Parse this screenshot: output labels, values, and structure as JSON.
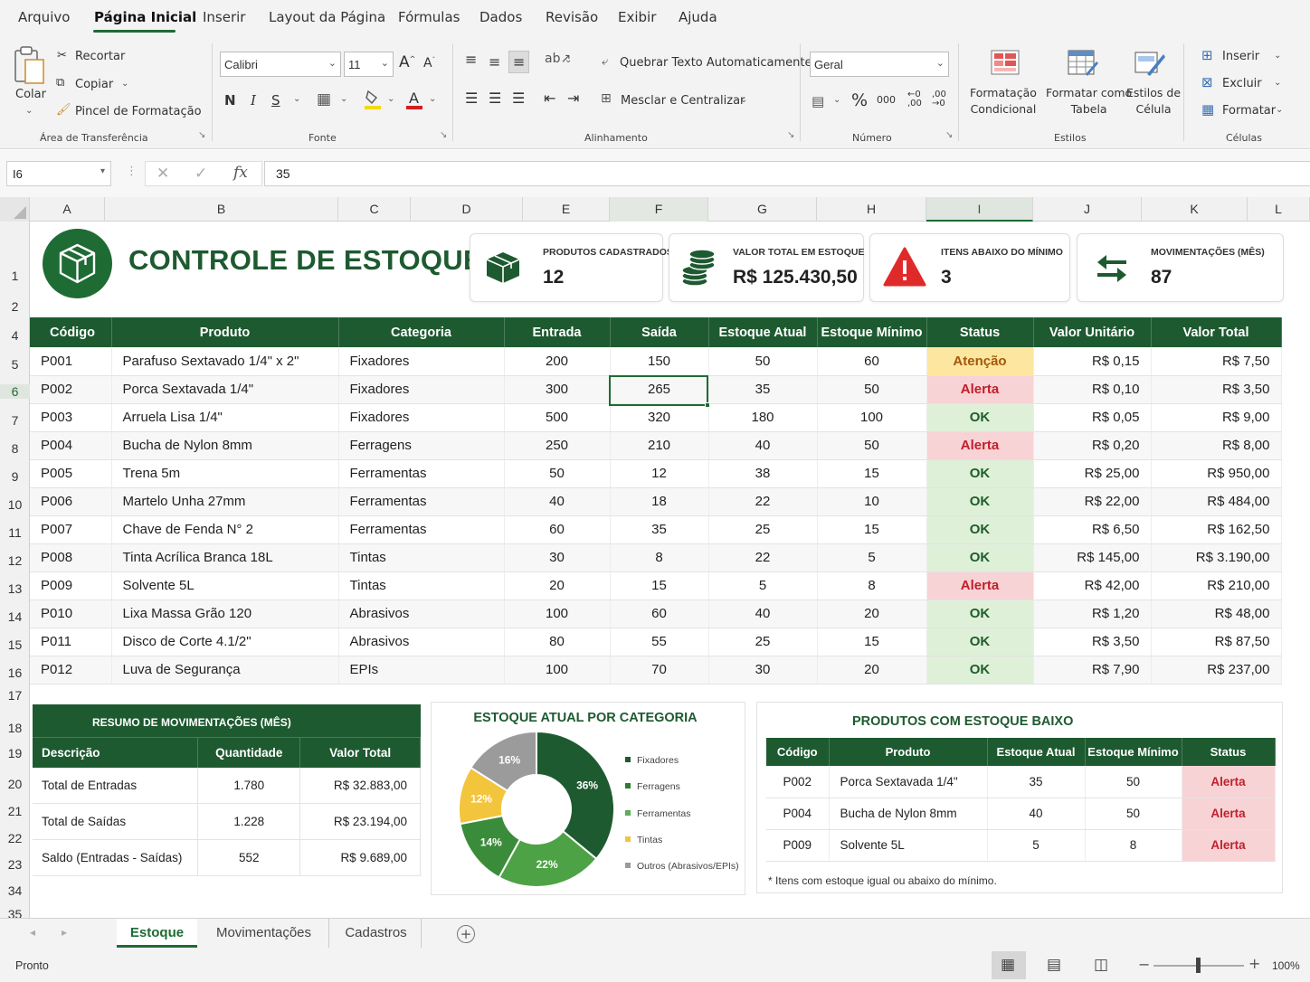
{
  "menu": {
    "tabs": [
      "Arquivo",
      "Página Inicial",
      "Inserir",
      "Layout da Página",
      "Fórmulas",
      "Dados",
      "Revisão",
      "Exibir",
      "Ajuda"
    ],
    "active": "Página Inicial"
  },
  "ribbon": {
    "clipboard": {
      "paste": "Colar",
      "cut": "Recortar",
      "copy": "Copiar",
      "format_painter": "Pincel de Formatação",
      "group": "Área de Transferência"
    },
    "font": {
      "name": "Calibri",
      "size": "11",
      "bold": "N",
      "italic": "I",
      "underline": "S",
      "group": "Fonte"
    },
    "alignment": {
      "wrap": "Quebrar Texto Automaticamente",
      "merge": "Mesclar e Centralizar",
      "group": "Alinhamento"
    },
    "number": {
      "format": "Geral",
      "percent": "%",
      "thousands": "000",
      "group": "Número"
    },
    "styles": {
      "conditional": "Formatação\nCondicional",
      "table": "Formatar como\nTabela",
      "cell_styles": "Estilos de\nCélula",
      "group": "Estilos"
    },
    "cells": {
      "insert": "Inserir",
      "delete": "Excluir",
      "format": "Formatar",
      "group": "Células"
    }
  },
  "formula_bar": {
    "name_box": "I6",
    "value": "35",
    "fx": "fx"
  },
  "columns": [
    "A",
    "B",
    "C",
    "D",
    "E",
    "F",
    "G",
    "H",
    "I",
    "J",
    "K",
    "L"
  ],
  "selected_column": "I",
  "rows": [
    "1",
    "2",
    "4",
    "5",
    "6",
    "7",
    "8",
    "9",
    "10",
    "11",
    "12",
    "13",
    "14",
    "15",
    "16",
    "17",
    "18",
    "19",
    "20",
    "21",
    "22",
    "23",
    "34",
    "35"
  ],
  "selected_row": "6",
  "dashboard": {
    "title": "CONTROLE DE ESTOQUE",
    "kpis": [
      {
        "label": "PRODUTOS CADASTRADOS",
        "value": "12"
      },
      {
        "label": "VALOR TOTAL EM ESTOQUE",
        "value": "R$ 125.430,50"
      },
      {
        "label": "ITENS ABAIXO DO MÍNIMO",
        "value": "3"
      },
      {
        "label": "MOVIMENTAÇÕES (MÊS)",
        "value": "87"
      }
    ]
  },
  "inventory": {
    "headers": [
      "Código",
      "Produto",
      "Categoria",
      "Entrada",
      "Saída",
      "Estoque Atual",
      "Estoque Mínimo",
      "Status",
      "Valor Unitário",
      "Valor Total"
    ],
    "rows": [
      [
        "P001",
        "Parafuso Sextavado 1/4\" x 2\"",
        "Fixadores",
        "200",
        "150",
        "50",
        "60",
        "Atenção",
        "R$ 0,15",
        "R$ 7,50"
      ],
      [
        "P002",
        "Porca Sextavada 1/4\"",
        "Fixadores",
        "300",
        "265",
        "35",
        "50",
        "Alerta",
        "R$ 0,10",
        "R$ 3,50"
      ],
      [
        "P003",
        "Arruela Lisa 1/4\"",
        "Fixadores",
        "500",
        "320",
        "180",
        "100",
        "OK",
        "R$ 0,05",
        "R$ 9,00"
      ],
      [
        "P004",
        "Bucha de Nylon 8mm",
        "Ferragens",
        "250",
        "210",
        "40",
        "50",
        "Alerta",
        "R$ 0,20",
        "R$ 8,00"
      ],
      [
        "P005",
        "Trena 5m",
        "Ferramentas",
        "50",
        "12",
        "38",
        "15",
        "OK",
        "R$ 25,00",
        "R$ 950,00"
      ],
      [
        "P006",
        "Martelo Unha 27mm",
        "Ferramentas",
        "40",
        "18",
        "22",
        "10",
        "OK",
        "R$ 22,00",
        "R$ 484,00"
      ],
      [
        "P007",
        "Chave de Fenda N° 2",
        "Ferramentas",
        "60",
        "35",
        "25",
        "15",
        "OK",
        "R$ 6,50",
        "R$ 162,50"
      ],
      [
        "P008",
        "Tinta Acrílica Branca 18L",
        "Tintas",
        "30",
        "8",
        "22",
        "5",
        "OK",
        "R$ 145,00",
        "R$ 3.190,00"
      ],
      [
        "P009",
        "Solvente 5L",
        "Tintas",
        "20",
        "15",
        "5",
        "8",
        "Alerta",
        "R$ 42,00",
        "R$ 210,00"
      ],
      [
        "P010",
        "Lixa Massa Grão 120",
        "Abrasivos",
        "100",
        "60",
        "40",
        "20",
        "OK",
        "R$ 1,20",
        "R$ 48,00"
      ],
      [
        "P011",
        "Disco de Corte 4.1/2\"",
        "Abrasivos",
        "80",
        "55",
        "25",
        "15",
        "OK",
        "R$ 3,50",
        "R$ 87,50"
      ],
      [
        "P012",
        "Luva de Segurança",
        "EPIs",
        "100",
        "70",
        "30",
        "20",
        "OK",
        "R$ 7,90",
        "R$ 237,00"
      ]
    ]
  },
  "movements": {
    "title": "RESUMO DE MOVIMENTAÇÕES (MÊS)",
    "headers": [
      "Descrição",
      "Quantidade",
      "Valor Total"
    ],
    "rows": [
      [
        "Total de Entradas",
        "1.780",
        "R$ 32.883,00"
      ],
      [
        "Total de Saídas",
        "1.228",
        "R$ 23.194,00"
      ],
      [
        "Saldo (Entradas - Saídas)",
        "552",
        "R$ 9.689,00"
      ]
    ]
  },
  "chart_data": {
    "type": "pie",
    "title": "ESTOQUE ATUAL POR CATEGORIA",
    "categories": [
      "Fixadores",
      "Ferragens",
      "Ferramentas",
      "Tintas",
      "Outros (Abrasivos/EPIs)"
    ],
    "values": [
      36,
      22,
      14,
      12,
      16
    ],
    "labels": [
      "36%",
      "22%",
      "14%",
      "12%",
      "16%"
    ],
    "colors": [
      "#1e5a30",
      "#4fa24c",
      "#3b8c3a",
      "#f2c53d",
      "#9b9b9b"
    ],
    "donut": true,
    "legend": "right"
  },
  "low_stock": {
    "title": "PRODUTOS COM ESTOQUE BAIXO",
    "headers": [
      "Código",
      "Produto",
      "Estoque Atual",
      "Estoque Mínimo",
      "Status"
    ],
    "rows": [
      [
        "P002",
        "Porca Sextavada 1/4\"",
        "35",
        "50",
        "Alerta"
      ],
      [
        "P004",
        "Bucha de Nylon 8mm",
        "40",
        "50",
        "Alerta"
      ],
      [
        "P009",
        "Solvente 5L",
        "5",
        "8",
        "Alerta"
      ]
    ],
    "note": "* Itens com estoque igual ou abaixo do mínimo."
  },
  "sheets": {
    "tabs": [
      "Estoque",
      "Movimentações",
      "Cadastros"
    ],
    "active": "Estoque"
  },
  "status": {
    "text": "Pronto",
    "zoom": "100%"
  },
  "colors": {
    "accent": "#1e5a30",
    "ok": "#dff0d9",
    "alert": "#f8d3d6",
    "warn": "#fde7a0"
  }
}
